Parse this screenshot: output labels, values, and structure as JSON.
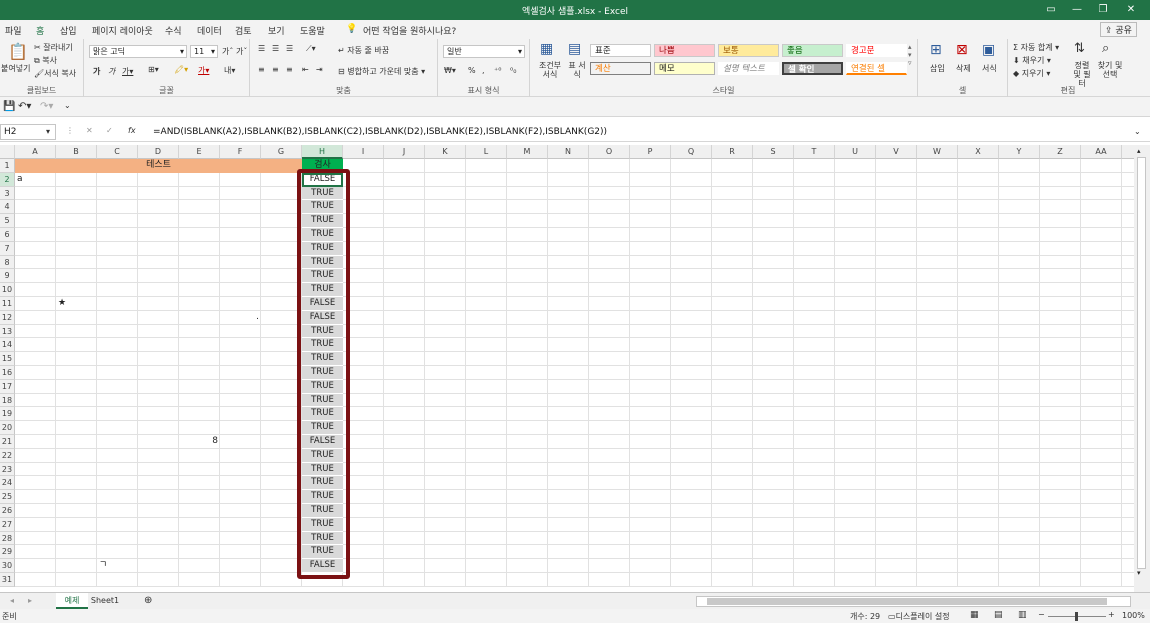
{
  "window": {
    "title": "엑셀검사 샘플.xlsx  -  Excel"
  },
  "menu": {
    "tabs": [
      "파일",
      "홈",
      "삽입",
      "페이지 레이아웃",
      "수식",
      "데이터",
      "검토",
      "보기",
      "도움말"
    ],
    "tell_me": "어떤 작업을 원하시나요?",
    "share": "공유"
  },
  "ribbon": {
    "clipboard": {
      "paste": "붙여넣기",
      "cut": "잘라내기",
      "copy": "복사",
      "format_painter": "서식 복사",
      "label": "클립보드"
    },
    "font": {
      "name": "맑은 고딕",
      "size": "11",
      "label": "글꼴"
    },
    "align": {
      "wrap": "자동 줄 바꿈",
      "merge": "병합하고 가운데 맞춤",
      "label": "맞춤"
    },
    "number": {
      "format": "일반",
      "label": "표시 형식"
    },
    "styles": {
      "cond_format": "조건부 서식",
      "table_format": "표 서식",
      "items": [
        "표준",
        "나쁨",
        "보통",
        "좋음",
        "경고문",
        "계산",
        "메모",
        "설명 텍스트",
        "셀 확인",
        "연결된 셀"
      ],
      "label": "스타일"
    },
    "cells": {
      "insert": "삽입",
      "delete": "삭제",
      "format": "서식",
      "label": "셀"
    },
    "editing": {
      "autosum": "자동 합계",
      "fill": "채우기",
      "clear": "지우기",
      "sort": "정렬 및 필터",
      "find": "찾기 및 선택",
      "label": "편집"
    }
  },
  "formula_bar": {
    "name_box": "H2",
    "fx": "fx",
    "formula": "=AND(ISBLANK(A2),ISBLANK(B2),ISBLANK(C2),ISBLANK(D2),ISBLANK(E2),ISBLANK(F2),ISBLANK(G2))"
  },
  "grid": {
    "columns": [
      "A",
      "B",
      "C",
      "D",
      "E",
      "F",
      "G",
      "H",
      "I",
      "J",
      "K",
      "L",
      "M",
      "N",
      "O",
      "P",
      "Q",
      "R",
      "S",
      "T",
      "U",
      "V",
      "W",
      "X",
      "Y",
      "Z",
      "AA",
      "AB"
    ],
    "rows": [
      1,
      2,
      3,
      4,
      5,
      6,
      7,
      8,
      9,
      10,
      11,
      12,
      13,
      14,
      15,
      16,
      17,
      18,
      19,
      20,
      21,
      22,
      23,
      24,
      25,
      26,
      27,
      28,
      29,
      30,
      31
    ],
    "header_title": "테스트",
    "header_check": "검사",
    "cell_a2": "a",
    "cell_b11": "★",
    "cell_g12": ".",
    "cell_e21": "8",
    "cell_c30": "ㄱ",
    "h_values": [
      "FALSE",
      "TRUE",
      "TRUE",
      "TRUE",
      "TRUE",
      "TRUE",
      "TRUE",
      "TRUE",
      "TRUE",
      "FALSE",
      "FALSE",
      "TRUE",
      "TRUE",
      "TRUE",
      "TRUE",
      "TRUE",
      "TRUE",
      "TRUE",
      "TRUE",
      "FALSE",
      "TRUE",
      "TRUE",
      "TRUE",
      "TRUE",
      "TRUE",
      "TRUE",
      "TRUE",
      "TRUE",
      "FALSE"
    ],
    "header_title_color": "#f4b183",
    "header_check_color": "#00b050",
    "highlight_color": "#7b1113"
  },
  "sheets": {
    "tabs": [
      "예제",
      "Sheet1"
    ],
    "active": "예제"
  },
  "status": {
    "ready": "준비",
    "count": "개수: 29",
    "display": "디스플레이 설정",
    "zoom": "100%"
  }
}
